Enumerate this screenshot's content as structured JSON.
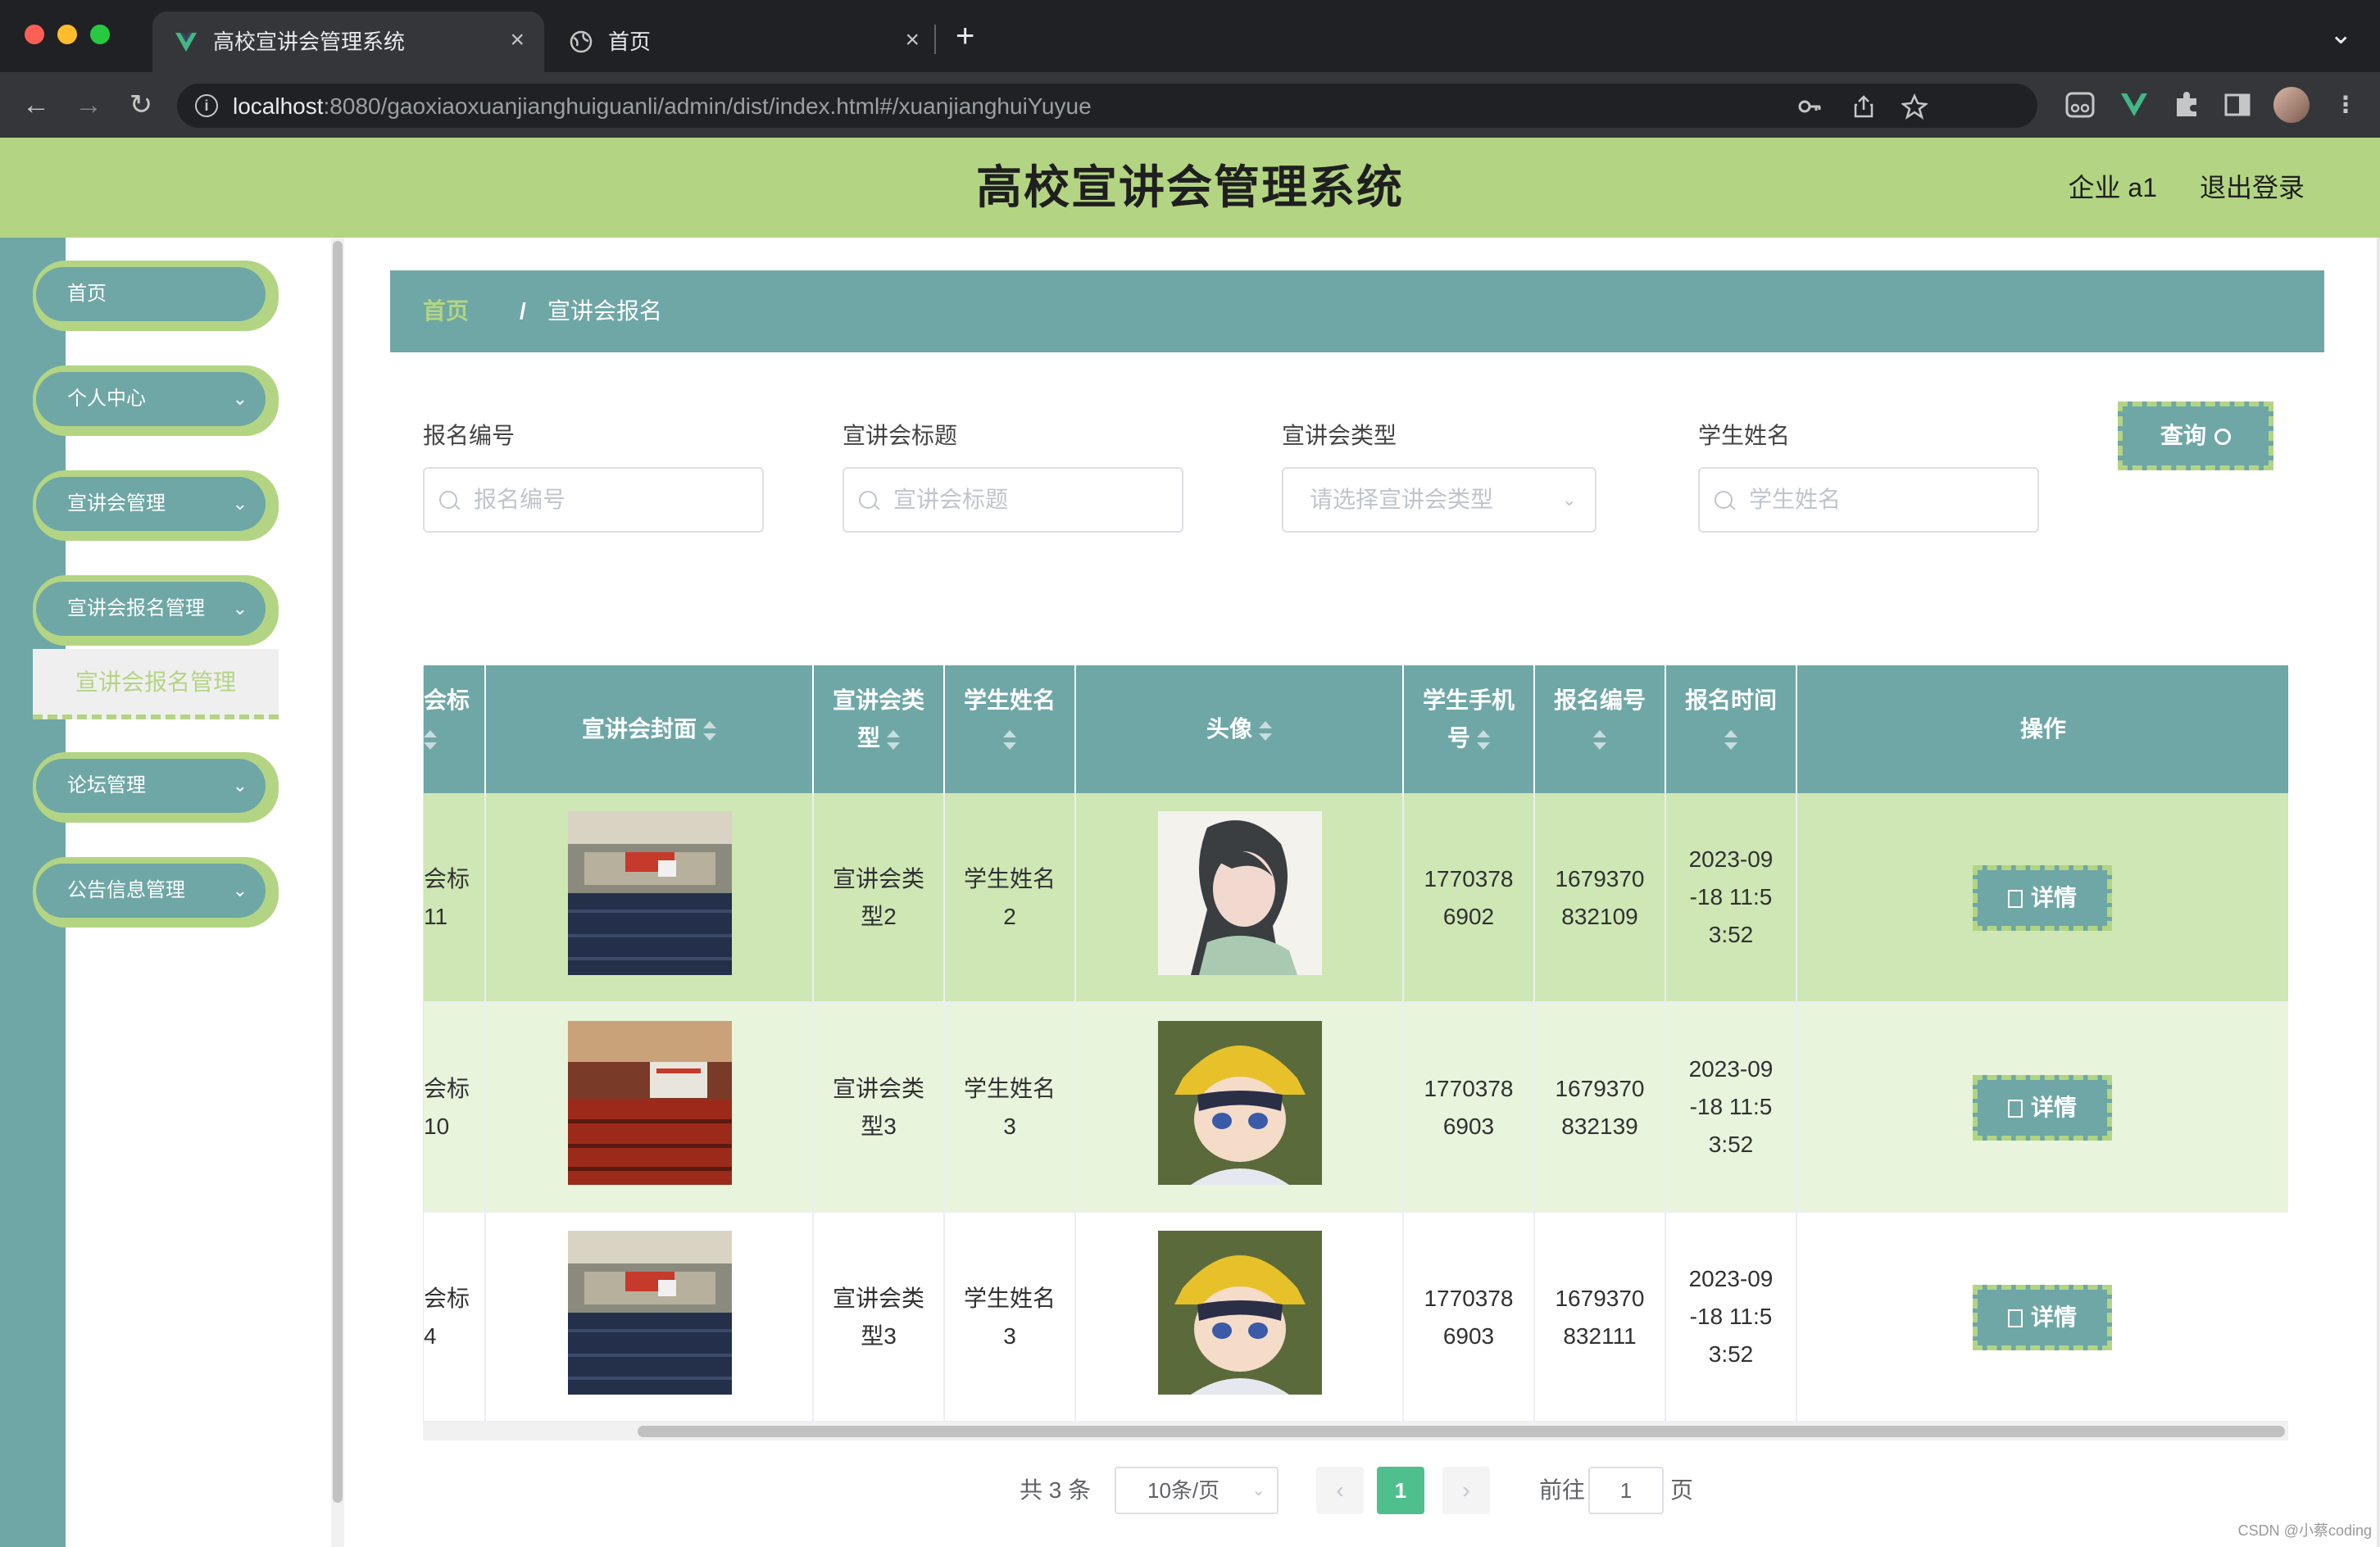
{
  "browser": {
    "tabs": [
      {
        "title": "高校宣讲会管理系统",
        "close": "×"
      },
      {
        "title": "首页",
        "close": "×"
      }
    ],
    "new_tab": "+",
    "url_host": "localhost",
    "url_rest": ":8080/gaoxiaoxuanjianghuiguanli/admin/dist/index.html#/xuanjianghuiYuyue",
    "tab_list_icon": "⌄"
  },
  "header": {
    "title": "高校宣讲会管理系统",
    "user": "企业 a1",
    "logout": "退出登录"
  },
  "sidebar": {
    "items": [
      {
        "label": "首页",
        "expandable": false
      },
      {
        "label": "个人中心",
        "expandable": true
      },
      {
        "label": "宣讲会管理",
        "expandable": true
      },
      {
        "label": "宣讲会报名管理",
        "expandable": true
      },
      {
        "label": "论坛管理",
        "expandable": true
      },
      {
        "label": "公告信息管理",
        "expandable": true
      }
    ],
    "active_sub": "宣讲会报名管理",
    "chevron": "⌄"
  },
  "breadcrumb": {
    "home": "首页",
    "sep": "/",
    "current": "宣讲会报名"
  },
  "search": {
    "fields": [
      {
        "label": "报名编号",
        "placeholder": "报名编号"
      },
      {
        "label": "宣讲会标题",
        "placeholder": "宣讲会标题"
      },
      {
        "label": "宣讲会类型",
        "placeholder": "请选择宣讲会类型"
      },
      {
        "label": "学生姓名",
        "placeholder": "学生姓名"
      }
    ],
    "button": "查询"
  },
  "table": {
    "columns": [
      "会标",
      "宣讲会封面",
      "宣讲会类型",
      "学生姓名",
      "头像",
      "学生手机号",
      "报名编号",
      "报名时间",
      "操作"
    ],
    "col1_header_lines": [
      "会标"
    ],
    "header_lines": {
      "type": [
        "宣讲会类",
        "型"
      ],
      "phone": [
        "学生手机",
        "号"
      ]
    },
    "rows": [
      {
        "title_lines": [
          "会标",
          "11"
        ],
        "type_lines": [
          "宣讲会类",
          "型2"
        ],
        "name_lines": [
          "学生姓名",
          "2"
        ],
        "phone_lines": [
          "1770378",
          "6902"
        ],
        "no_lines": [
          "1679370",
          "832109"
        ],
        "time_lines": [
          "2023-09",
          "-18 11:5",
          "3:52"
        ],
        "action": "详情"
      },
      {
        "title_lines": [
          "会标",
          "10"
        ],
        "type_lines": [
          "宣讲会类",
          "型3"
        ],
        "name_lines": [
          "学生姓名",
          "3"
        ],
        "phone_lines": [
          "1770378",
          "6903"
        ],
        "no_lines": [
          "1679370",
          "832139"
        ],
        "time_lines": [
          "2023-09",
          "-18 11:5",
          "3:52"
        ],
        "action": "详情"
      },
      {
        "title_lines": [
          "会标",
          "4"
        ],
        "type_lines": [
          "宣讲会类",
          "型3"
        ],
        "name_lines": [
          "学生姓名",
          "3"
        ],
        "phone_lines": [
          "1770378",
          "6903"
        ],
        "no_lines": [
          "1679370",
          "832111"
        ],
        "time_lines": [
          "2023-09",
          "-18 11:5",
          "3:52"
        ],
        "action": "详情"
      }
    ]
  },
  "pagination": {
    "total": "共 3 条",
    "page_size": "10条/页",
    "prev": "‹",
    "current": "1",
    "next": "›",
    "goto_label": "前往",
    "goto_value": "1",
    "goto_suffix": "页"
  },
  "watermark": "CSDN @小蔡coding",
  "colors": {
    "accent_green": "#b3d583",
    "teal": "#6ea7a6",
    "row_green": "#cfe7b4",
    "row_light": "#e8f4dc",
    "active_page": "#4fc08d"
  }
}
